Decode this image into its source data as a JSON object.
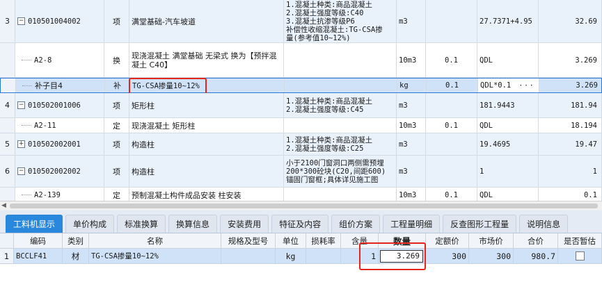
{
  "rows": [
    {
      "num": "3",
      "code": "010501004002",
      "type": "项",
      "name": "满堂基础-汽车坡道",
      "feature": [
        "1.混凝土种类:商品混凝土",
        "2.混凝土强度等级:C40",
        "3.混凝土抗渗等级P6",
        "补偿性收缩混凝土:TG-CSA掺",
        "量(参考值10~12%)"
      ],
      "unit": "m3",
      "content": "",
      "expr": "27.7371+4.95",
      "qty": "32.69"
    },
    {
      "num": "",
      "code": "A2-8",
      "type": "换",
      "name": "现浇混凝土 满堂基础 无梁式  换为【预拌混凝土 C40】",
      "feature": [],
      "unit": "10m3",
      "content": "0.1",
      "expr": "QDL",
      "qty": "3.269"
    },
    {
      "num": "",
      "code": "补子目4",
      "type": "补",
      "name": "TG-CSA掺量10~12%",
      "feature": [],
      "unit": "kg",
      "content": "0.1",
      "expr": "QDL*0.1",
      "expr_more": "···",
      "qty": "3.269"
    },
    {
      "num": "4",
      "code": "010502001006",
      "type": "项",
      "name": "矩形柱",
      "feature": [
        "1.混凝土种类:商品混凝土",
        "2.混凝土强度等级:C45"
      ],
      "unit": "m3",
      "content": "",
      "expr": "181.9443",
      "qty": "181.94"
    },
    {
      "num": "",
      "code": "A2-11",
      "type": "定",
      "name": "现浇混凝土 矩形柱",
      "feature": [],
      "unit": "10m3",
      "content": "0.1",
      "expr": "QDL",
      "qty": "18.194"
    },
    {
      "num": "5",
      "code": "010502002001",
      "type": "项",
      "name": "构造柱",
      "feature": [
        "1.混凝土种类:商品混凝土",
        "2.混凝土强度等级:C25"
      ],
      "unit": "m3",
      "content": "",
      "expr": "19.4695",
      "qty": "19.47"
    },
    {
      "num": "6",
      "code": "010502002002",
      "type": "项",
      "name": "构造柱",
      "feature": [
        "小于2100门窗洞口两侧需预埋",
        "200*300砼块(C20,间距600)",
        "锚固门窗框;具体详见施工图"
      ],
      "unit": "m3",
      "content": "",
      "expr": "1",
      "qty": "1"
    },
    {
      "num": "",
      "code": "A2-139",
      "type": "定",
      "name": "预制混凝土构件成品安装 柱安装",
      "feature": [],
      "unit": "10m3",
      "content": "0.1",
      "expr": "QDL",
      "qty": "0.1"
    }
  ],
  "tabs": [
    "工料机显示",
    "单价构成",
    "标准换算",
    "换算信息",
    "安装费用",
    "特征及内容",
    "组价方案",
    "工程量明细",
    "反查图形工程量",
    "说明信息"
  ],
  "bottom": {
    "headers": [
      "编码",
      "类别",
      "名称",
      "规格及型号",
      "单位",
      "损耗率",
      "含量",
      "数量",
      "定额价",
      "市场价",
      "合价",
      "是否暂估"
    ],
    "row": {
      "num": "1",
      "code": "BCCLF41",
      "category": "材",
      "name": "TG-CSA掺量10~12%",
      "spec": "",
      "unit": "kg",
      "loss": "",
      "content": "1",
      "qty": "3.269",
      "quota_price": "300",
      "market_price": "300",
      "total": "980.7"
    }
  },
  "colors": {
    "accent": "#2a88dc",
    "highlight": "#e3261b",
    "selected_row": "#cfe2f7"
  }
}
